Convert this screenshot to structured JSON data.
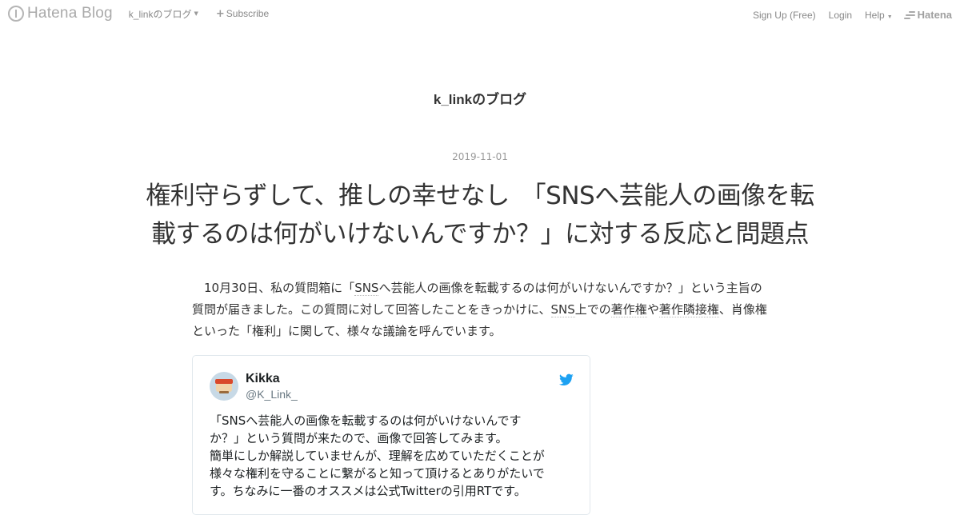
{
  "global_header": {
    "logo_text": "Hatena Blog",
    "blog_menu_label": "k_linkのブログ",
    "subscribe_label": "Subscribe",
    "signup_label": "Sign Up (Free)",
    "login_label": "Login",
    "help_label": "Help",
    "hatena_label": "Hatena"
  },
  "blog": {
    "title": "k_linkのブログ"
  },
  "entry": {
    "date": "2019-11-01",
    "title_line1": "権利守らずして、推しの幸せなし　「SNSへ芸能人の画像を転",
    "title_line2": "載するのは何がいけないんですか？」に対する反応と問題点",
    "body": {
      "p1": "10月30日、私の質問箱に「",
      "kw1": "SNS",
      "p2": "へ芸能人の画像を転載するのは何がいけないんですか？」という主旨の質問が届きました。この質問に対して回答したことをきっかけに、",
      "kw2": "SNS",
      "p3": "上での",
      "kw3": "著作権",
      "p4": "や",
      "kw4": "著作隣接権",
      "p5": "、肖像権といった「権利」に関して、様々な議論を呼んでいます。"
    }
  },
  "tweet": {
    "name": "Kikka",
    "handle": "@K_Link_",
    "avatar_icon": "user-avatar-icon",
    "bird_icon": "twitter-bird-icon",
    "accent_color": "#1da1f2",
    "lines": [
      "「SNSへ芸能人の画像を転載するのは何がいけないんです",
      "か？」という質問が来たので、画像で回答してみます。",
      "簡単にしか解説していませんが、理解を広めていただくことが",
      "様々な権利を守ることに繋がると知って頂けるとありがたいで",
      "す。ちなみに一番のオススメは公式Twitterの引用RTです。"
    ]
  }
}
